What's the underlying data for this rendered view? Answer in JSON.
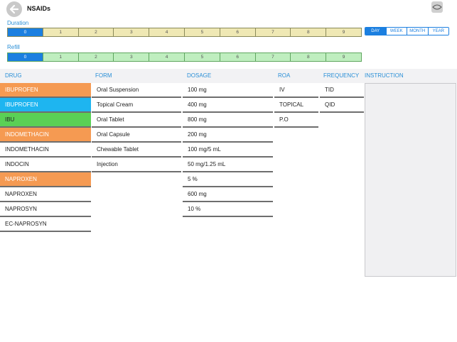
{
  "header": {
    "title": "NSAIDs",
    "back_icon": "arrow-left-icon",
    "eye_icon": "eye-icon"
  },
  "duration": {
    "label": "Duration",
    "options": [
      "0",
      "1",
      "2",
      "3",
      "4",
      "5",
      "6",
      "7",
      "8",
      "9"
    ],
    "selected": "0"
  },
  "duration_unit": {
    "options": [
      "DAY",
      "WEEK",
      "MONTH",
      "YEAR"
    ],
    "selected": "DAY"
  },
  "refill": {
    "label": "Refill",
    "options": [
      "0",
      "1",
      "2",
      "3",
      "4",
      "5",
      "6",
      "7",
      "8",
      "9"
    ],
    "selected": "0"
  },
  "columns": {
    "drug": "DRUG",
    "form": "FORM",
    "dosage": "DOSAGE",
    "roa": "ROA",
    "frequency": "FREQUENCY",
    "instruction": "INSTRUCTION"
  },
  "drugs": [
    {
      "name": "IBUPROFEN",
      "color": "#f59a52",
      "text_color": "#ffffff"
    },
    {
      "name": "IBUPROFEN",
      "color": "#1eb5f0",
      "text_color": "#ffffff"
    },
    {
      "name": "IBU",
      "color": "#5ad055",
      "text_color": "#222222"
    },
    {
      "name": "INDOMETHACIN",
      "color": "#f59a52",
      "text_color": "#ffffff"
    },
    {
      "name": "INDOMETHACIN",
      "color": "#ffffff",
      "text_color": "#222222"
    },
    {
      "name": "INDOCIN",
      "color": "#ffffff",
      "text_color": "#222222"
    },
    {
      "name": "NAPROXEN",
      "color": "#f59a52",
      "text_color": "#ffffff"
    },
    {
      "name": "NAPROXEN",
      "color": "#ffffff",
      "text_color": "#222222"
    },
    {
      "name": "NAPROSYN",
      "color": "#ffffff",
      "text_color": "#222222"
    },
    {
      "name": "EC-NAPROSYN",
      "color": "#ffffff",
      "text_color": "#222222"
    }
  ],
  "forms": [
    "Oral Suspension",
    "Topical Cream",
    "Oral Tablet",
    "Oral Capsule",
    "Chewable Tablet",
    "Injection"
  ],
  "dosages": [
    "100 mg",
    "400 mg",
    "800 mg",
    "200 mg",
    "100 mg/5 mL",
    "50 mg/1.25 mL",
    "5 %",
    "600 mg",
    "10 %"
  ],
  "roa": [
    "IV",
    "TOPICAL",
    "P.O"
  ],
  "frequency": [
    "TID",
    "QID"
  ]
}
